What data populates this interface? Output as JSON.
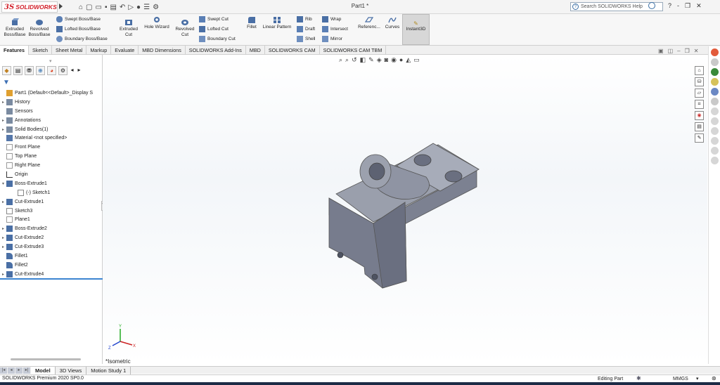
{
  "app": {
    "logo_ds": "3S",
    "logo_name": "SOLIDWORKS",
    "doc_title": "Part1 *",
    "help_search_placeholder": "Search SOLIDWORKS Help",
    "window_controls": [
      "?",
      "-",
      "❐",
      "✕"
    ]
  },
  "ribbon": {
    "extruded_boss": [
      "Extruded",
      "Boss/Base"
    ],
    "revolved_boss": [
      "Revolved",
      "Boss/Base"
    ],
    "swept_boss": "Swept Boss/Base",
    "lofted_boss": "Lofted Boss/Base",
    "boundary_boss": "Boundary Boss/Base",
    "extruded_cut": [
      "Extruded",
      "Cut"
    ],
    "hole_wizard": "Hole Wizard",
    "revolved_cut": [
      "Revolved",
      "Cut"
    ],
    "swept_cut": "Swept Cut",
    "lofted_cut": "Lofted Cut",
    "boundary_cut": "Boundary Cut",
    "fillet": "Fillet",
    "linear_pattern": "Linear Pattern",
    "rib": "Rib",
    "wrap": "Wrap",
    "draft": "Draft",
    "intersect": "Intersect",
    "shell": "Shell",
    "mirror": "Mirror",
    "reference": "Referenc...",
    "curves": "Curves",
    "instant3d": "Instant3D"
  },
  "command_tabs": [
    "Features",
    "Sketch",
    "Sheet Metal",
    "Markup",
    "Evaluate",
    "MBD Dimensions",
    "SOLIDWORKS Add-Ins",
    "MBD",
    "SOLIDWORKS CAM",
    "SOLIDWORKS CAM TBM"
  ],
  "tree": [
    {
      "label": "Part1  (Default<<Default>_Display S",
      "expand": "",
      "icon": "part-icon",
      "color": "#e0a030"
    },
    {
      "label": "History",
      "expand": "▸",
      "icon": "history-icon",
      "color": "#7a8aa0"
    },
    {
      "label": "Sensors",
      "expand": "",
      "icon": "sensors-icon",
      "color": "#7a8aa0"
    },
    {
      "label": "Annotations",
      "expand": "▸",
      "icon": "annotations-icon",
      "color": "#7a8aa0"
    },
    {
      "label": "Solid Bodies(1)",
      "expand": "▸",
      "icon": "solid-bodies-icon",
      "color": "#7a8aa0"
    },
    {
      "label": "Material <not specified>",
      "expand": "",
      "icon": "material-icon",
      "color": "#5577aa"
    },
    {
      "label": "Front Plane",
      "expand": "",
      "icon": "plane-icon",
      "color": "#9a9a9a"
    },
    {
      "label": "Top Plane",
      "expand": "",
      "icon": "plane-icon",
      "color": "#9a9a9a"
    },
    {
      "label": "Right Plane",
      "expand": "",
      "icon": "plane-icon",
      "color": "#9a9a9a"
    },
    {
      "label": "Origin",
      "expand": "",
      "icon": "origin-icon",
      "color": "#333333"
    },
    {
      "label": "Boss-Extrude1",
      "expand": "▾",
      "icon": "boss-extrude-icon",
      "color": "#4a6fa5"
    },
    {
      "label": "(-) Sketch1",
      "expand": "",
      "icon": "sketch-icon",
      "color": "#888888",
      "indent": true
    },
    {
      "label": "Cut-Extrude1",
      "expand": "▸",
      "icon": "cut-extrude-icon",
      "color": "#4a6fa5"
    },
    {
      "label": "Sketch3",
      "expand": "",
      "icon": "sketch-icon",
      "color": "#888888"
    },
    {
      "label": "Plane1",
      "expand": "",
      "icon": "plane-icon",
      "color": "#9a9a9a"
    },
    {
      "label": "Boss-Extrude2",
      "expand": "▸",
      "icon": "boss-extrude-icon",
      "color": "#4a6fa5"
    },
    {
      "label": "Cut-Extrude2",
      "expand": "▸",
      "icon": "cut-extrude-icon",
      "color": "#4a6fa5"
    },
    {
      "label": "Cut-Extrude3",
      "expand": "▸",
      "icon": "cut-extrude-icon",
      "color": "#4a6fa5"
    },
    {
      "label": "Fillet1",
      "expand": "",
      "icon": "fillet-icon",
      "color": "#4a6fa5"
    },
    {
      "label": "Fillet2",
      "expand": "",
      "icon": "fillet-icon",
      "color": "#4a6fa5"
    },
    {
      "label": "Cut-Extrude4",
      "expand": "▸",
      "icon": "cut-extrude-icon",
      "color": "#4a6fa5"
    }
  ],
  "viewport": {
    "view_label": "*Isometric",
    "model_color": "#8a8f9e",
    "triad_colors": {
      "x": "#cc2222",
      "y": "#22aa22",
      "z": "#2244cc"
    }
  },
  "bottom_tabs": [
    "Model",
    "3D Views",
    "Motion Study 1"
  ],
  "status": {
    "version": "SOLIDWORKS Premium 2020 SP0.0",
    "mode": "Editing Part",
    "units": "MMGS"
  }
}
